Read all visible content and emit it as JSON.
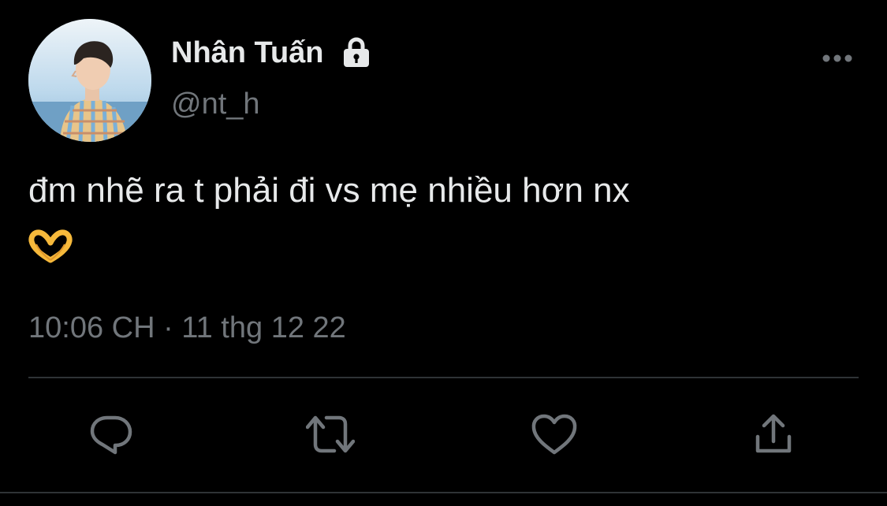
{
  "tweet": {
    "author": {
      "display_name": "Nhân Tuấn",
      "handle": "@nt_h",
      "protected_icon": "lock-icon",
      "avatar": "profile-photo"
    },
    "text": "đm nhẽ ra t phải đi vs mẹ nhiều hơn nx",
    "emoji": "heart-hands-emoji",
    "timestamp": "10:06 CH · 11 thg 12 22",
    "menu_icon": "more-horizontal-icon"
  },
  "actions": [
    {
      "name": "reply",
      "icon": "reply-icon"
    },
    {
      "name": "retweet",
      "icon": "retweet-icon"
    },
    {
      "name": "like",
      "icon": "heart-icon"
    },
    {
      "name": "share",
      "icon": "share-icon"
    }
  ],
  "colors": {
    "background": "#000000",
    "primary_text": "#e7e9ea",
    "secondary_text": "#71767b",
    "divider": "#2f3336"
  }
}
